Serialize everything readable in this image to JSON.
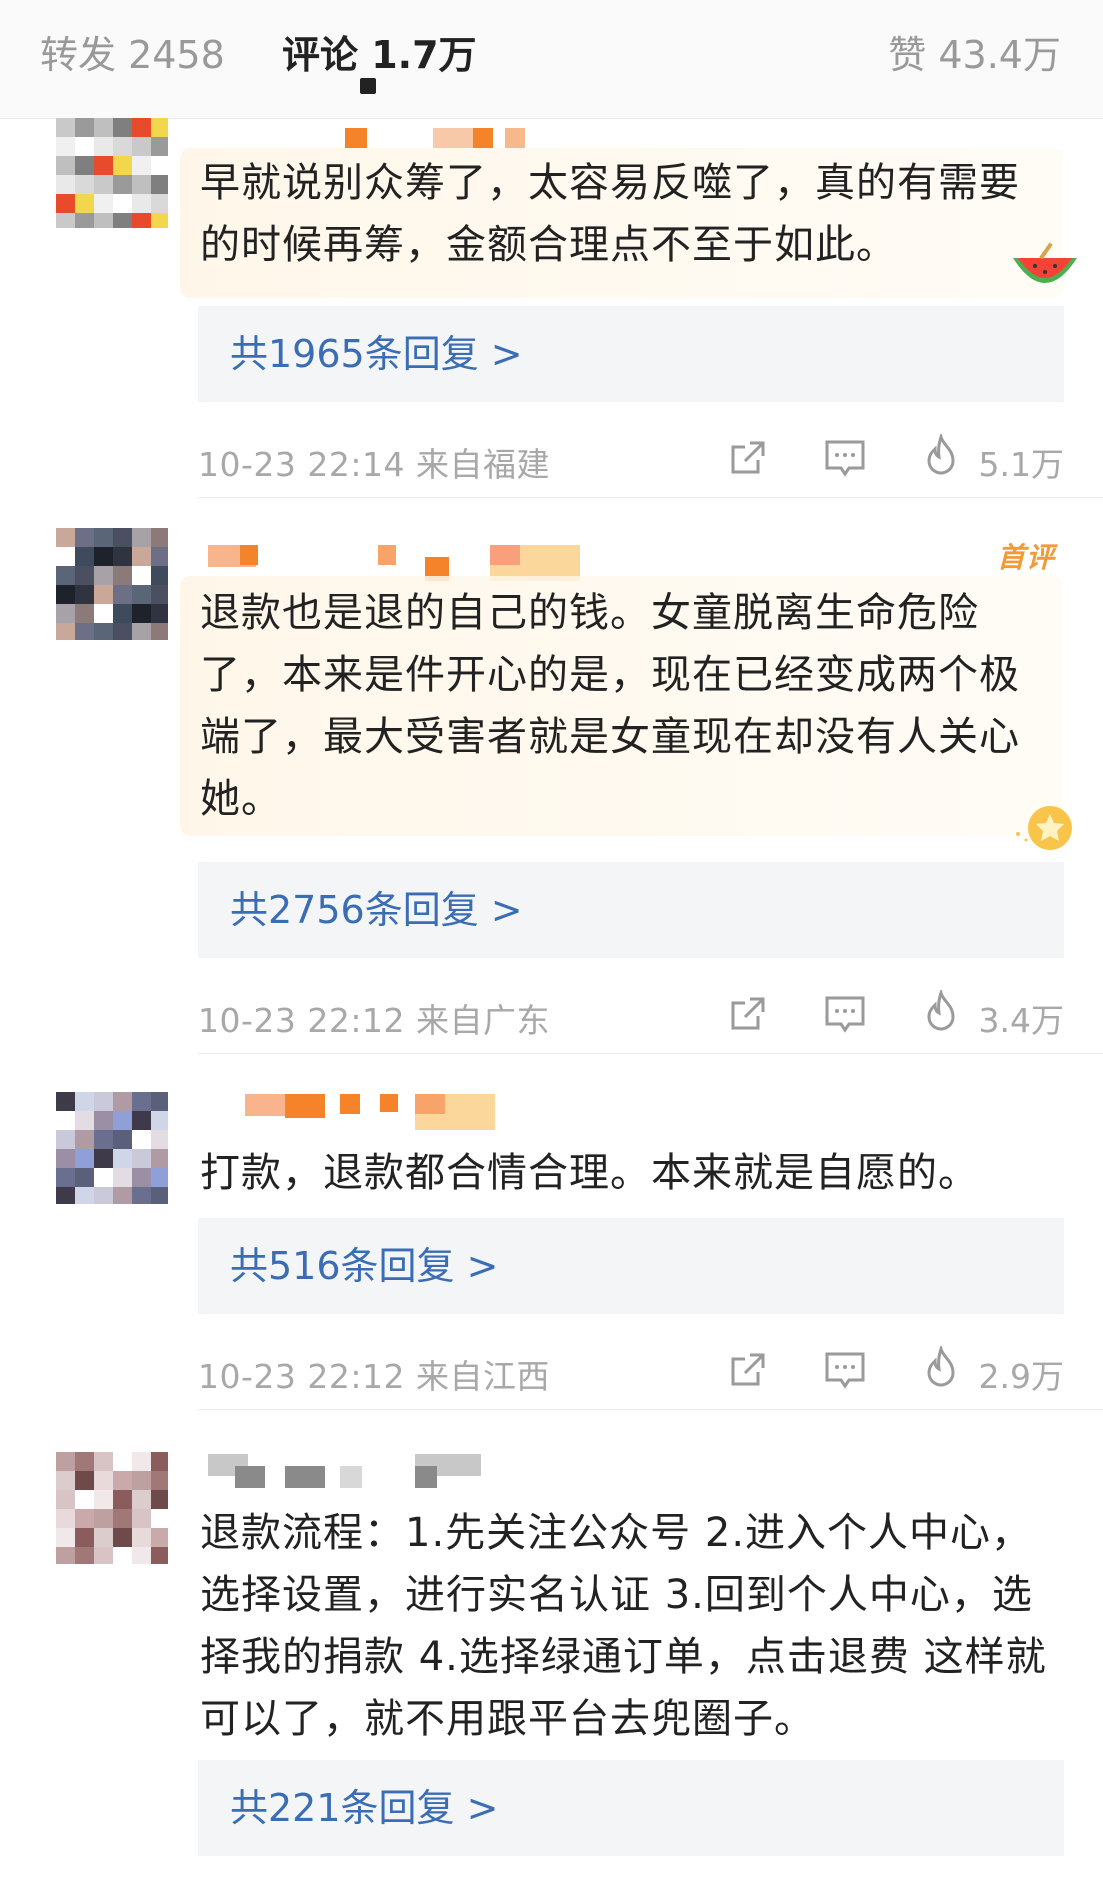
{
  "tabs": {
    "forward": "转发 2458",
    "comment": "评论 1.7万",
    "likes": "赞 43.4万"
  },
  "comments": [
    {
      "text": "早就说别众筹了，太容易反噬了，真的有需要的时候再筹，金额合理点不至于如此。",
      "replies": "共1965条回复 >",
      "time": "10-23 22:14 来自福建",
      "likes": "5.1万",
      "icons": [
        "share-icon",
        "reply-icon",
        "fire-like-icon"
      ]
    },
    {
      "badge": "首评",
      "text": "退款也是退的自己的钱。女童脱离生命危险了，本来是件开心的是，现在已经变成两个极端了，最大受害者就是女童现在却没有人关心她。",
      "replies": "共2756条回复 >",
      "time": "10-23 22:12 来自广东",
      "likes": "3.4万",
      "icons": [
        "share-icon",
        "reply-icon",
        "fire-like-icon"
      ]
    },
    {
      "text": "打款，退款都合情合理。本来就是自愿的。",
      "replies": "共516条回复 >",
      "time": "10-23 22:12 来自江西",
      "likes": "2.9万",
      "icons": [
        "share-icon",
        "reply-icon",
        "fire-like-icon"
      ]
    },
    {
      "text": "退款流程：1.先关注公众号 2.进入个人中心，选择设置，进行实名认证 3.回到个人中心，选择我的捐款 4.选择绿通订单，点击退费 这样就可以了，就不用跟平台去兜圈子。",
      "replies": "共221条回复 >"
    }
  ],
  "colors": {
    "reply_link": "#3a6db4",
    "badge": "#f29a38",
    "meta": "#a8a8a8",
    "reply_bg": "#f4f5f7"
  }
}
